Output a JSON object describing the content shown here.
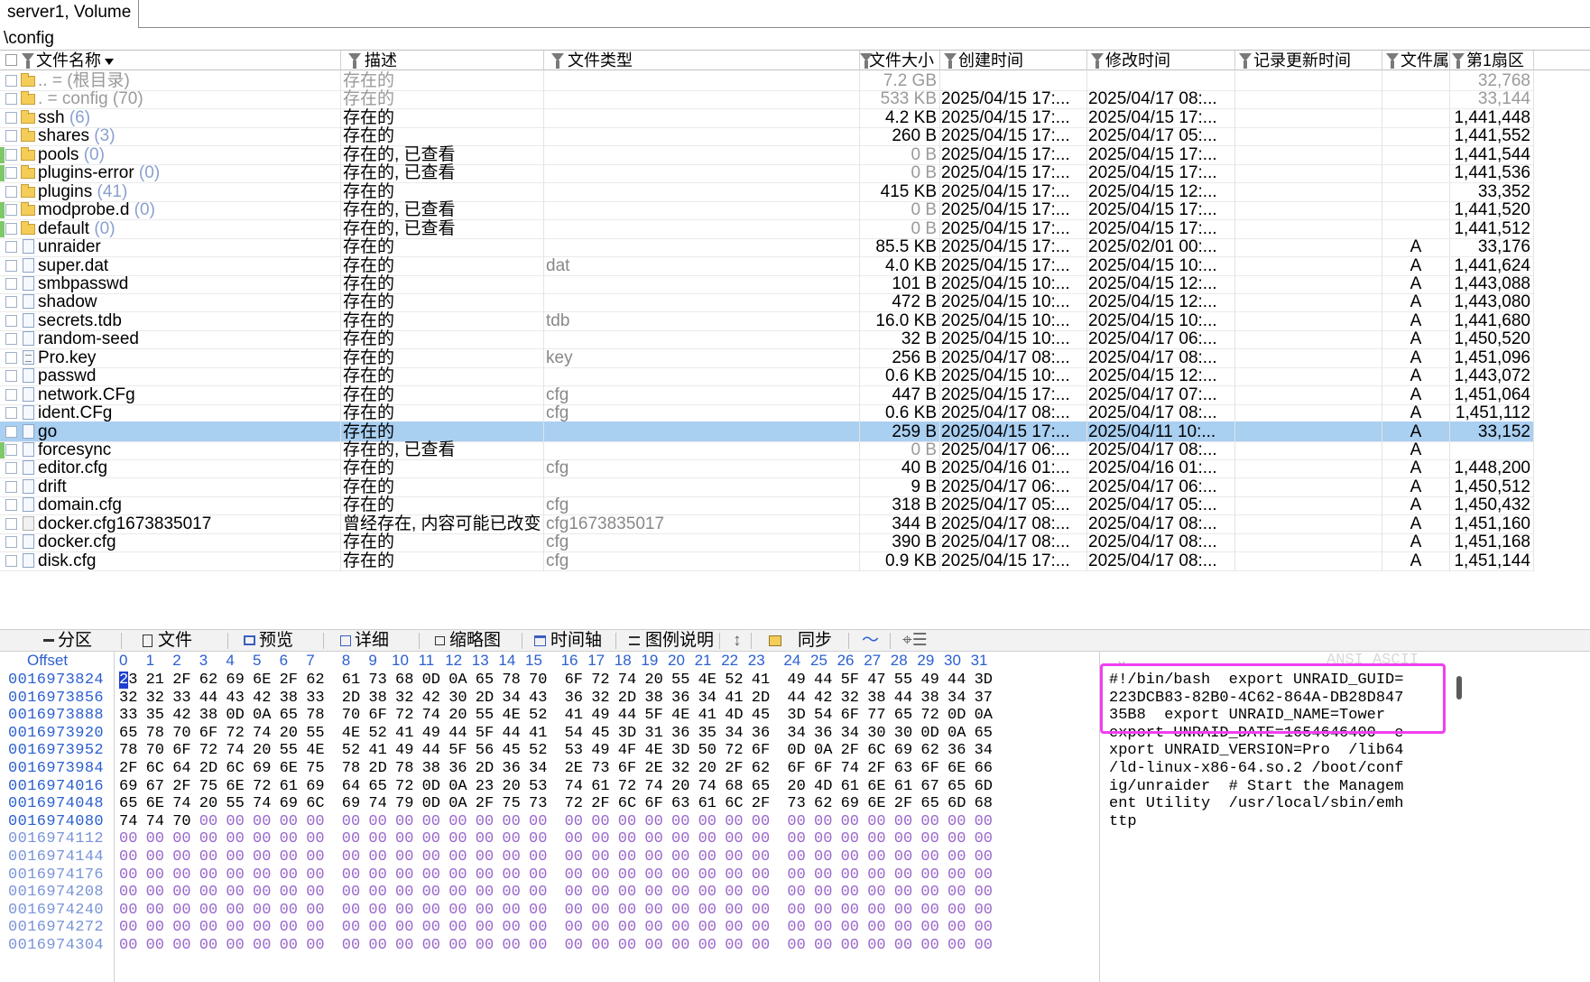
{
  "tab": {
    "label": "server1, Volume"
  },
  "path": "\\config",
  "columns": {
    "name": "文件名称",
    "desc": "描述",
    "type": "文件类型",
    "size": "文件大小",
    "created": "创建时间",
    "modified": "修改时间",
    "record_updated": "记录更新时间",
    "attr": "文件属",
    "first_sector": "第1扇区"
  },
  "rows": [
    {
      "icon": "folder",
      "name": "..",
      "name_suffix": " =  (根目录)",
      "desc": "存在的",
      "type": "",
      "size": "7.2 GB",
      "created": "",
      "modified": "",
      "rtime": "",
      "attr": "",
      "sector": "32,768",
      "dim": true,
      "green": false,
      "count": ""
    },
    {
      "icon": "folder",
      "name": ".",
      "name_suffix": "  =  config (70)",
      "desc": "存在的",
      "type": "",
      "size": "533 KB",
      "created": "2025/04/15  17:...",
      "modified": "2025/04/17  08:...",
      "rtime": "",
      "attr": "",
      "sector": "33,144",
      "dim": true,
      "green": false,
      "count": ""
    },
    {
      "icon": "folder",
      "name": "ssh",
      "count": "(6)",
      "desc": "存在的",
      "type": "",
      "size": "4.2 KB",
      "created": "2025/04/15  17:...",
      "modified": "2025/04/15  17:...",
      "rtime": "",
      "attr": "",
      "sector": "1,441,448",
      "green": false
    },
    {
      "icon": "folder",
      "name": "shares",
      "count": "(3)",
      "desc": "存在的",
      "type": "",
      "size": "260 B",
      "created": "2025/04/15  17:...",
      "modified": "2025/04/17  05:...",
      "rtime": "",
      "attr": "",
      "sector": "1,441,552",
      "green": false
    },
    {
      "icon": "folder",
      "name": "pools",
      "count": "(0)",
      "desc": "存在的, 已查看",
      "type": "",
      "size": "0 B",
      "created": "2025/04/15  17:...",
      "modified": "2025/04/15  17:...",
      "rtime": "",
      "attr": "",
      "sector": "1,441,544",
      "green": true
    },
    {
      "icon": "folder",
      "name": "plugins-error",
      "count": "(0)",
      "desc": "存在的, 已查看",
      "type": "",
      "size": "0 B",
      "created": "2025/04/15  17:...",
      "modified": "2025/04/15  17:...",
      "rtime": "",
      "attr": "",
      "sector": "1,441,536",
      "green": true
    },
    {
      "icon": "folder",
      "name": "plugins",
      "count": "(41)",
      "desc": "存在的",
      "type": "",
      "size": "415 KB",
      "created": "2025/04/15  17:...",
      "modified": "2025/04/15  12:...",
      "rtime": "",
      "attr": "",
      "sector": "33,352",
      "green": false
    },
    {
      "icon": "folder",
      "name": "modprobe.d",
      "count": "(0)",
      "desc": "存在的, 已查看",
      "type": "",
      "size": "0 B",
      "created": "2025/04/15  17:...",
      "modified": "2025/04/15  17:...",
      "rtime": "",
      "attr": "",
      "sector": "1,441,520",
      "green": true
    },
    {
      "icon": "folder",
      "name": "default",
      "count": "(0)",
      "desc": "存在的, 已查看",
      "type": "",
      "size": "0 B",
      "created": "2025/04/15  17:...",
      "modified": "2025/04/15  17:...",
      "rtime": "",
      "attr": "",
      "sector": "1,441,512",
      "green": true
    },
    {
      "icon": "file",
      "name": "unraider",
      "count": "",
      "desc": "存在的",
      "type": "",
      "size": "85.5 KB",
      "created": "2025/04/15  17:...",
      "modified": "2025/02/01  00:...",
      "rtime": "",
      "attr": "A",
      "sector": "33,176",
      "green": false
    },
    {
      "icon": "file",
      "name": "super.dat",
      "count": "",
      "desc": "存在的",
      "type": "dat",
      "size": "4.0 KB",
      "created": "2025/04/15  17:...",
      "modified": "2025/04/15  10:...",
      "rtime": "",
      "attr": "A",
      "sector": "1,441,624",
      "green": false
    },
    {
      "icon": "file",
      "name": "smbpasswd",
      "count": "",
      "desc": "存在的",
      "type": "",
      "size": "101 B",
      "created": "2025/04/15  10:...",
      "modified": "2025/04/15  12:...",
      "rtime": "",
      "attr": "A",
      "sector": "1,443,088",
      "green": false
    },
    {
      "icon": "file",
      "name": "shadow",
      "count": "",
      "desc": "存在的",
      "type": "",
      "size": "472 B",
      "created": "2025/04/15  10:...",
      "modified": "2025/04/15  12:...",
      "rtime": "",
      "attr": "A",
      "sector": "1,443,080",
      "green": false
    },
    {
      "icon": "file",
      "name": "secrets.tdb",
      "count": "",
      "desc": "存在的",
      "type": "tdb",
      "size": "16.0 KB",
      "created": "2025/04/15  10:...",
      "modified": "2025/04/15  10:...",
      "rtime": "",
      "attr": "A",
      "sector": "1,441,680",
      "green": false
    },
    {
      "icon": "file",
      "name": "random-seed",
      "count": "",
      "desc": "存在的",
      "type": "",
      "size": "32 B",
      "created": "2025/04/15  10:...",
      "modified": "2025/04/17  06:...",
      "rtime": "",
      "attr": "A",
      "sector": "1,450,520",
      "green": false
    },
    {
      "icon": "text",
      "name": "Pro.key",
      "count": "",
      "desc": "存在的",
      "type": "key",
      "size": "256 B",
      "created": "2025/04/17  08:...",
      "modified": "2025/04/17  08:...",
      "rtime": "",
      "attr": "A",
      "sector": "1,451,096",
      "green": false
    },
    {
      "icon": "file",
      "name": "passwd",
      "count": "",
      "desc": "存在的",
      "type": "",
      "size": "0.6 KB",
      "created": "2025/04/15  10:...",
      "modified": "2025/04/15  12:...",
      "rtime": "",
      "attr": "A",
      "sector": "1,443,072",
      "green": false
    },
    {
      "icon": "file",
      "name": "network.CFg",
      "count": "",
      "desc": "存在的",
      "type": "cfg",
      "size": "447 B",
      "created": "2025/04/15  17:...",
      "modified": "2025/04/17  07:...",
      "rtime": "",
      "attr": "A",
      "sector": "1,451,064",
      "green": false
    },
    {
      "icon": "file",
      "name": "ident.CFg",
      "count": "",
      "desc": "存在的",
      "type": "cfg",
      "size": "0.6 KB",
      "created": "2025/04/17  08:...",
      "modified": "2025/04/17  08:...",
      "rtime": "",
      "attr": "A",
      "sector": "1,451,112",
      "green": false
    },
    {
      "icon": "file",
      "name": "go",
      "count": "",
      "desc": "存在的",
      "type": "",
      "size": "259 B",
      "created": "2025/04/15  17:...",
      "modified": "2025/04/11  10:...",
      "rtime": "",
      "attr": "A",
      "sector": "33,152",
      "green": false,
      "selected": true
    },
    {
      "icon": "file",
      "name": "forcesync",
      "count": "",
      "desc": "存在的, 已查看",
      "type": "",
      "size": "0 B",
      "created": "2025/04/17  06:...",
      "modified": "2025/04/17  08:...",
      "rtime": "",
      "attr": "A",
      "sector": "",
      "green": true
    },
    {
      "icon": "file",
      "name": "editor.cfg",
      "count": "",
      "desc": "存在的",
      "type": "cfg",
      "size": "40 B",
      "created": "2025/04/16  01:...",
      "modified": "2025/04/16  01:...",
      "rtime": "",
      "attr": "A",
      "sector": "1,448,200",
      "green": false
    },
    {
      "icon": "file",
      "name": "drift",
      "count": "",
      "desc": "存在的",
      "type": "",
      "size": "9 B",
      "created": "2025/04/17  06:...",
      "modified": "2025/04/17  06:...",
      "rtime": "",
      "attr": "A",
      "sector": "1,450,512",
      "green": false
    },
    {
      "icon": "file",
      "name": "domain.cfg",
      "count": "",
      "desc": "存在的",
      "type": "cfg",
      "size": "318 B",
      "created": "2025/04/17  05:...",
      "modified": "2025/04/17  05:...",
      "rtime": "",
      "attr": "A",
      "sector": "1,450,432",
      "green": false
    },
    {
      "icon": "old",
      "name": "docker.cfg1673835017",
      "count": "",
      "desc": "曾经存在, 内容可能已改变",
      "type": "cfg1673835017",
      "size": "344 B",
      "created": "2025/04/17  08:...",
      "modified": "2025/04/17  08:...",
      "rtime": "",
      "attr": "A",
      "sector": "1,451,160",
      "green": false
    },
    {
      "icon": "file",
      "name": "docker.cfg",
      "count": "",
      "desc": "存在的",
      "type": "cfg",
      "size": "390 B",
      "created": "2025/04/17  08:...",
      "modified": "2025/04/17  08:...",
      "rtime": "",
      "attr": "A",
      "sector": "1,451,168",
      "green": false
    },
    {
      "icon": "file",
      "name": "disk.cfg",
      "count": "",
      "desc": "存在的",
      "type": "cfg",
      "size": "0.9 KB",
      "created": "2025/04/15  17:...",
      "modified": "2025/04/17  08:...",
      "rtime": "",
      "attr": "A",
      "sector": "1,451,144",
      "green": false
    }
  ],
  "toolbar": {
    "partition": "分区",
    "file": "文件",
    "preview": "预览",
    "details": "详细",
    "thumbnail": "缩略图",
    "timeline": "时间轴",
    "legend": "图例说明",
    "sync": "同步"
  },
  "hex": {
    "offset_label": "Offset",
    "column_labels": [
      "0",
      "1",
      "2",
      "3",
      "4",
      "5",
      "6",
      "7",
      "8",
      "9",
      "10",
      "11",
      "12",
      "13",
      "14",
      "15",
      "16",
      "17",
      "18",
      "19",
      "20",
      "21",
      "22",
      "23",
      "24",
      "25",
      "26",
      "27",
      "28",
      "29",
      "30",
      "31"
    ],
    "ascii_label": "ANSI ASCII",
    "rows": [
      {
        "offset": "0016973824",
        "bytes": [
          "23",
          "21",
          "2F",
          "62",
          "69",
          "6E",
          "2F",
          "62",
          "61",
          "73",
          "68",
          "0D",
          "0A",
          "65",
          "78",
          "70",
          "6F",
          "72",
          "74",
          "20",
          "55",
          "4E",
          "52",
          "41",
          "49",
          "44",
          "5F",
          "47",
          "55",
          "49",
          "44",
          "3D"
        ],
        "ascii": "#!/bin/bash  export UNRAID_GUID="
      },
      {
        "offset": "0016973856",
        "bytes": [
          "32",
          "32",
          "33",
          "44",
          "43",
          "42",
          "38",
          "33",
          "2D",
          "38",
          "32",
          "42",
          "30",
          "2D",
          "34",
          "43",
          "36",
          "32",
          "2D",
          "38",
          "36",
          "34",
          "41",
          "2D",
          "44",
          "42",
          "32",
          "38",
          "44",
          "38",
          "34",
          "37"
        ],
        "ascii": "223DCB83-82B0-4C62-864A-DB28D847"
      },
      {
        "offset": "0016973888",
        "bytes": [
          "33",
          "35",
          "42",
          "38",
          "0D",
          "0A",
          "65",
          "78",
          "70",
          "6F",
          "72",
          "74",
          "20",
          "55",
          "4E",
          "52",
          "41",
          "49",
          "44",
          "5F",
          "4E",
          "41",
          "4D",
          "45",
          "3D",
          "54",
          "6F",
          "77",
          "65",
          "72",
          "0D",
          "0A"
        ],
        "ascii": "35B8  export UNRAID_NAME=Tower  "
      },
      {
        "offset": "0016973920",
        "bytes": [
          "65",
          "78",
          "70",
          "6F",
          "72",
          "74",
          "20",
          "55",
          "4E",
          "52",
          "41",
          "49",
          "44",
          "5F",
          "44",
          "41",
          "54",
          "45",
          "3D",
          "31",
          "36",
          "35",
          "34",
          "36",
          "34",
          "36",
          "34",
          "30",
          "30",
          "0D",
          "0A",
          "65"
        ],
        "ascii": "export UNRAID_DATE=1654646400  e"
      },
      {
        "offset": "0016973952",
        "bytes": [
          "78",
          "70",
          "6F",
          "72",
          "74",
          "20",
          "55",
          "4E",
          "52",
          "41",
          "49",
          "44",
          "5F",
          "56",
          "45",
          "52",
          "53",
          "49",
          "4F",
          "4E",
          "3D",
          "50",
          "72",
          "6F",
          "0D",
          "0A",
          "2F",
          "6C",
          "69",
          "62",
          "36",
          "34"
        ],
        "ascii": "xport UNRAID_VERSION=Pro  /lib64"
      },
      {
        "offset": "0016973984",
        "bytes": [
          "2F",
          "6C",
          "64",
          "2D",
          "6C",
          "69",
          "6E",
          "75",
          "78",
          "2D",
          "78",
          "38",
          "36",
          "2D",
          "36",
          "34",
          "2E",
          "73",
          "6F",
          "2E",
          "32",
          "20",
          "2F",
          "62",
          "6F",
          "6F",
          "74",
          "2F",
          "63",
          "6F",
          "6E",
          "66"
        ],
        "ascii": "/ld-linux-x86-64.so.2 /boot/conf"
      },
      {
        "offset": "0016974016",
        "bytes": [
          "69",
          "67",
          "2F",
          "75",
          "6E",
          "72",
          "61",
          "69",
          "64",
          "65",
          "72",
          "0D",
          "0A",
          "23",
          "20",
          "53",
          "74",
          "61",
          "72",
          "74",
          "20",
          "74",
          "68",
          "65",
          "20",
          "4D",
          "61",
          "6E",
          "61",
          "67",
          "65",
          "6D"
        ],
        "ascii": "ig/unraider  # Start the Managem"
      },
      {
        "offset": "0016974048",
        "bytes": [
          "65",
          "6E",
          "74",
          "20",
          "55",
          "74",
          "69",
          "6C",
          "69",
          "74",
          "79",
          "0D",
          "0A",
          "2F",
          "75",
          "73",
          "72",
          "2F",
          "6C",
          "6F",
          "63",
          "61",
          "6C",
          "2F",
          "73",
          "62",
          "69",
          "6E",
          "2F",
          "65",
          "6D",
          "68"
        ],
        "ascii": "ent Utility  /usr/local/sbin/emh"
      },
      {
        "offset": "0016974080",
        "bytes": [
          "74",
          "74",
          "70",
          "00",
          "00",
          "00",
          "00",
          "00",
          "00",
          "00",
          "00",
          "00",
          "00",
          "00",
          "00",
          "00",
          "00",
          "00",
          "00",
          "00",
          "00",
          "00",
          "00",
          "00",
          "00",
          "00",
          "00",
          "00",
          "00",
          "00",
          "00",
          "00"
        ],
        "ascii": "ttp"
      },
      {
        "offset": "0016974112",
        "bytes": [
          "00",
          "00",
          "00",
          "00",
          "00",
          "00",
          "00",
          "00",
          "00",
          "00",
          "00",
          "00",
          "00",
          "00",
          "00",
          "00",
          "00",
          "00",
          "00",
          "00",
          "00",
          "00",
          "00",
          "00",
          "00",
          "00",
          "00",
          "00",
          "00",
          "00",
          "00",
          "00"
        ],
        "ascii": ""
      },
      {
        "offset": "0016974144",
        "bytes": [
          "00",
          "00",
          "00",
          "00",
          "00",
          "00",
          "00",
          "00",
          "00",
          "00",
          "00",
          "00",
          "00",
          "00",
          "00",
          "00",
          "00",
          "00",
          "00",
          "00",
          "00",
          "00",
          "00",
          "00",
          "00",
          "00",
          "00",
          "00",
          "00",
          "00",
          "00",
          "00"
        ],
        "ascii": ""
      },
      {
        "offset": "0016974176",
        "bytes": [
          "00",
          "00",
          "00",
          "00",
          "00",
          "00",
          "00",
          "00",
          "00",
          "00",
          "00",
          "00",
          "00",
          "00",
          "00",
          "00",
          "00",
          "00",
          "00",
          "00",
          "00",
          "00",
          "00",
          "00",
          "00",
          "00",
          "00",
          "00",
          "00",
          "00",
          "00",
          "00"
        ],
        "ascii": ""
      },
      {
        "offset": "0016974208",
        "bytes": [
          "00",
          "00",
          "00",
          "00",
          "00",
          "00",
          "00",
          "00",
          "00",
          "00",
          "00",
          "00",
          "00",
          "00",
          "00",
          "00",
          "00",
          "00",
          "00",
          "00",
          "00",
          "00",
          "00",
          "00",
          "00",
          "00",
          "00",
          "00",
          "00",
          "00",
          "00",
          "00"
        ],
        "ascii": ""
      },
      {
        "offset": "0016974240",
        "bytes": [
          "00",
          "00",
          "00",
          "00",
          "00",
          "00",
          "00",
          "00",
          "00",
          "00",
          "00",
          "00",
          "00",
          "00",
          "00",
          "00",
          "00",
          "00",
          "00",
          "00",
          "00",
          "00",
          "00",
          "00",
          "00",
          "00",
          "00",
          "00",
          "00",
          "00",
          "00",
          "00"
        ],
        "ascii": ""
      },
      {
        "offset": "0016974272",
        "bytes": [
          "00",
          "00",
          "00",
          "00",
          "00",
          "00",
          "00",
          "00",
          "00",
          "00",
          "00",
          "00",
          "00",
          "00",
          "00",
          "00",
          "00",
          "00",
          "00",
          "00",
          "00",
          "00",
          "00",
          "00",
          "00",
          "00",
          "00",
          "00",
          "00",
          "00",
          "00",
          "00"
        ],
        "ascii": ""
      },
      {
        "offset": "0016974304",
        "bytes": [
          "00",
          "00",
          "00",
          "00",
          "00",
          "00",
          "00",
          "00",
          "00",
          "00",
          "00",
          "00",
          "00",
          "00",
          "00",
          "00",
          "00",
          "00",
          "00",
          "00",
          "00",
          "00",
          "00",
          "00",
          "00",
          "00",
          "00",
          "00",
          "00",
          "00",
          "00",
          "00"
        ],
        "ascii": ""
      }
    ]
  },
  "colors": {
    "selected_row": "#a9cff1",
    "offset_blue": "#2b5fd0",
    "zero_byte": "#9a66cc",
    "highlight_box": "#f03ff0",
    "viewed_marker": "#7ec86a"
  }
}
